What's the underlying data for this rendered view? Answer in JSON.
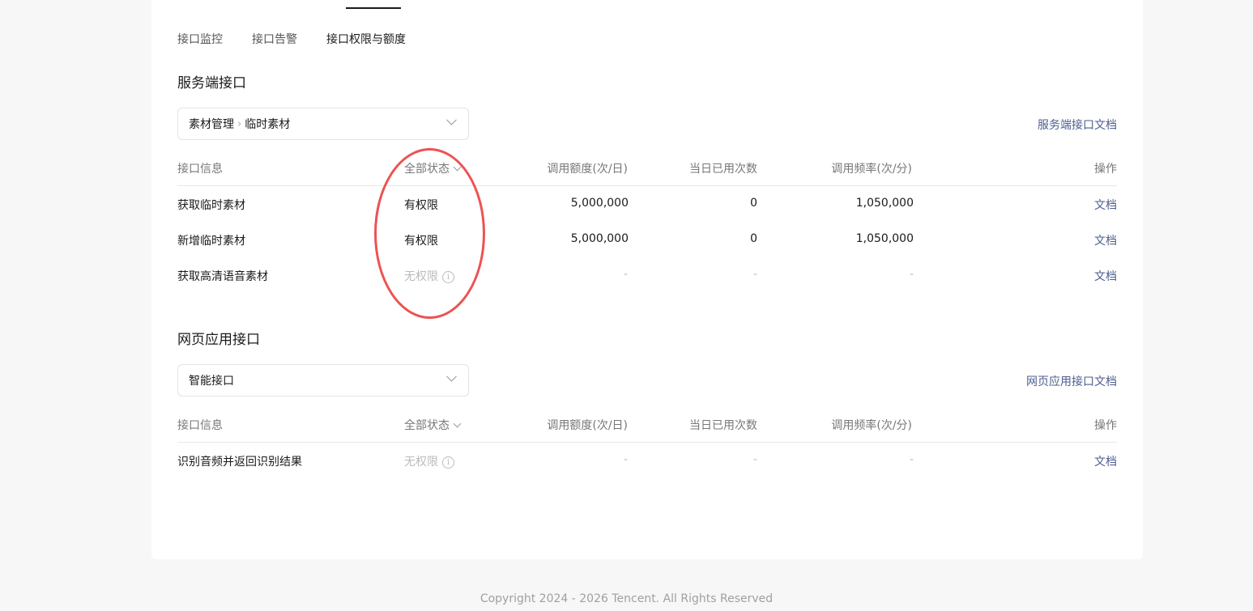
{
  "tabs": {
    "monitor": "接口监控",
    "alarm": "接口告警",
    "permission": "接口权限与额度"
  },
  "server": {
    "title": "服务端接口",
    "select_main": "素材管理",
    "select_sub": "临时素材",
    "doc_link": "服务端接口文档",
    "headers": {
      "info": "接口信息",
      "status": "全部状态",
      "quota": "调用额度(次/日)",
      "used": "当日已用次数",
      "freq": "调用频率(次/分)",
      "op": "操作"
    },
    "rows": [
      {
        "name": "获取临时素材",
        "status": "有权限",
        "quota": "5,000,000",
        "used": "0",
        "freq": "1,050,000",
        "op": "文档"
      },
      {
        "name": "新增临时素材",
        "status": "有权限",
        "quota": "5,000,000",
        "used": "0",
        "freq": "1,050,000",
        "op": "文档"
      },
      {
        "name": "获取高清语音素材",
        "status": "无权限",
        "quota": "-",
        "used": "-",
        "freq": "-",
        "op": "文档"
      }
    ]
  },
  "web": {
    "title": "网页应用接口",
    "select_main": "智能接口",
    "doc_link": "网页应用接口文档",
    "headers": {
      "info": "接口信息",
      "status": "全部状态",
      "quota": "调用额度(次/日)",
      "used": "当日已用次数",
      "freq": "调用频率(次/分)",
      "op": "操作"
    },
    "rows": [
      {
        "name": "识别音频并返回识别结果",
        "status": "无权限",
        "quota": "-",
        "used": "-",
        "freq": "-",
        "op": "文档"
      }
    ]
  },
  "info_glyph": "i",
  "footer": "Copyright 2024 - 2026 Tencent. All Rights Reserved",
  "annotation_color": "#ee5252",
  "link_color": "#4d5d8f"
}
